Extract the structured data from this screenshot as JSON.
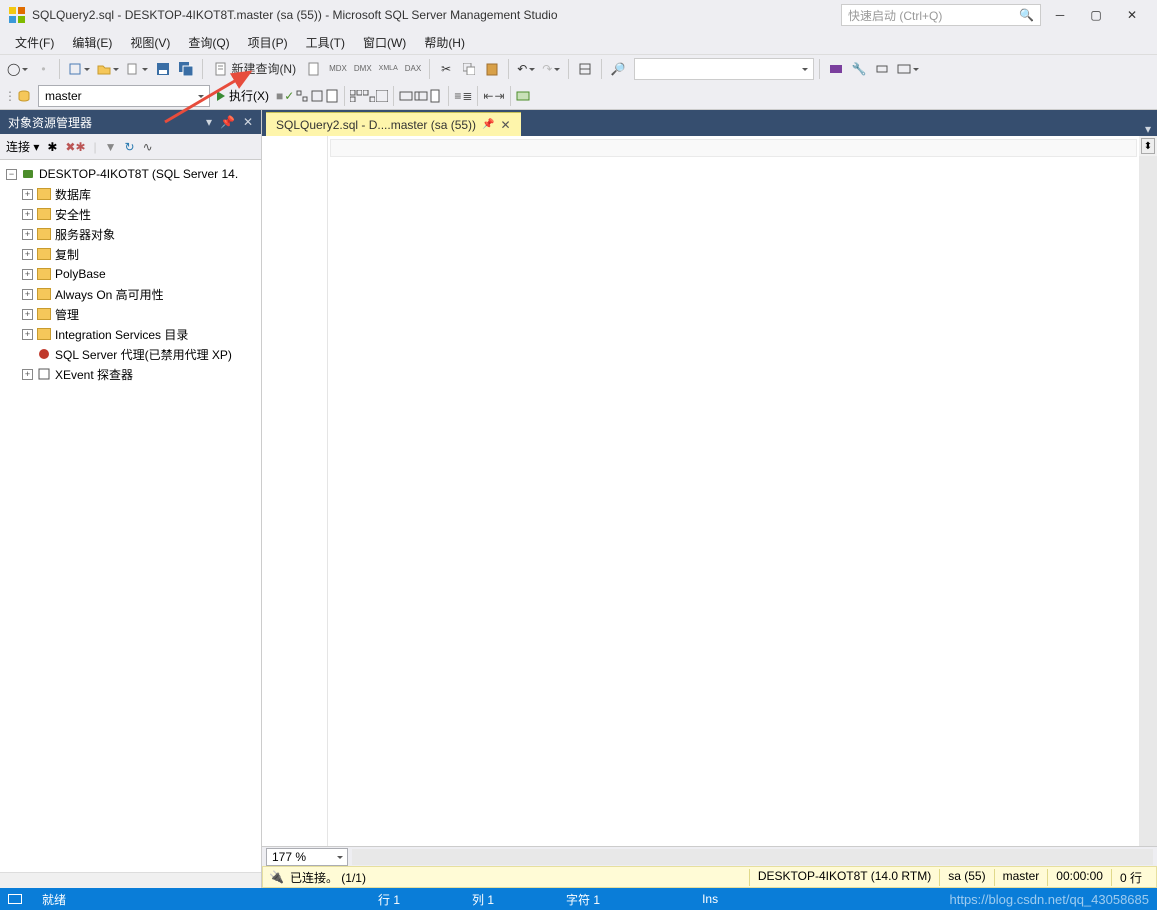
{
  "title": "SQLQuery2.sql - DESKTOP-4IKOT8T.master (sa (55)) - Microsoft SQL Server Management Studio",
  "quicklaunch_placeholder": "快速启动 (Ctrl+Q)",
  "menu": {
    "file": "文件(F)",
    "edit": "编辑(E)",
    "view": "视图(V)",
    "query": "查询(Q)",
    "project": "项目(P)",
    "tools": "工具(T)",
    "window": "窗口(W)",
    "help": "帮助(H)"
  },
  "toolbar": {
    "new_query": "新建查询(N)"
  },
  "toolbar2": {
    "database": "master",
    "execute": "执行(X)"
  },
  "sidebar": {
    "title": "对象资源管理器",
    "connect_label": "连接 ▾",
    "server": "DESKTOP-4IKOT8T (SQL Server 14.",
    "nodes": {
      "databases": "数据库",
      "security": "安全性",
      "server_objects": "服务器对象",
      "replication": "复制",
      "polybase": "PolyBase",
      "alwayson": "Always On 高可用性",
      "management": "管理",
      "integration": "Integration Services 目录",
      "agent": "SQL Server 代理(已禁用代理 XP)",
      "xevent": "XEvent 探查器"
    }
  },
  "tab": {
    "label": "SQLQuery2.sql - D....master (sa (55))"
  },
  "zoom": "177 %",
  "conn_status": {
    "connected": "已连接。 (1/1)",
    "server": "DESKTOP-4IKOT8T (14.0 RTM)",
    "user": "sa (55)",
    "db": "master",
    "time": "00:00:00",
    "rows": "0 行"
  },
  "statusbar": {
    "ready": "就绪",
    "line": "行 1",
    "col": "列 1",
    "char": "字符 1",
    "ins": "Ins",
    "watermark": "https://blog.csdn.net/qq_43058685"
  }
}
